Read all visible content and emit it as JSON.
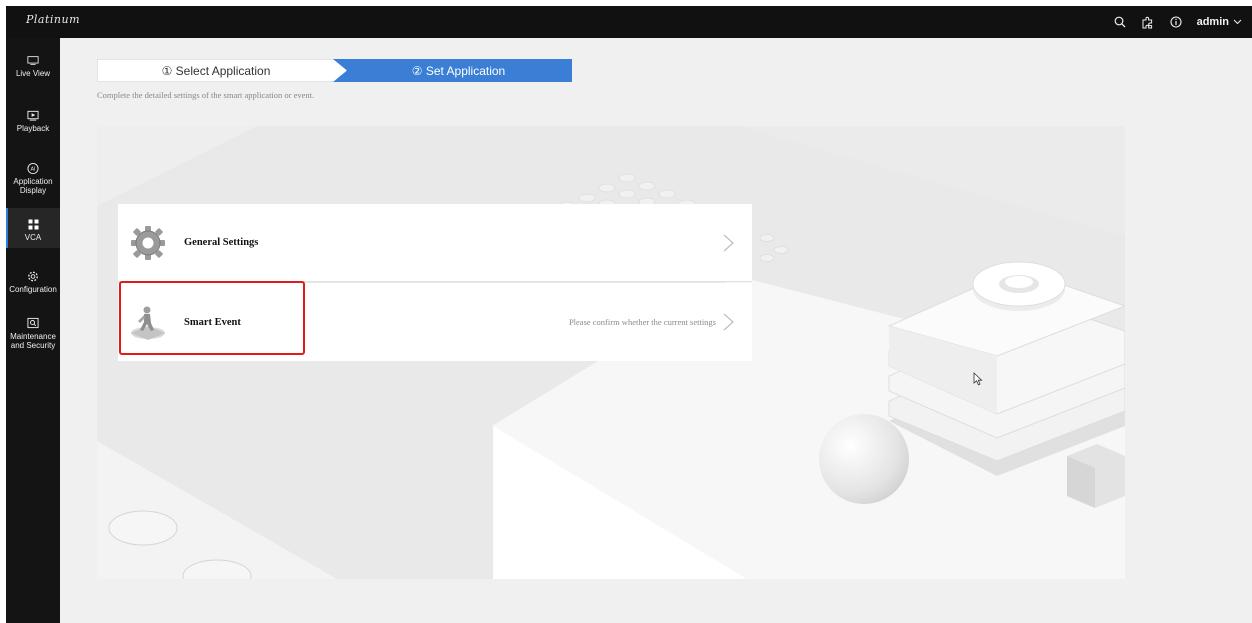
{
  "app": {
    "logo": "Platinum"
  },
  "header": {
    "user": "admin"
  },
  "sidebar": {
    "items": [
      {
        "label": "Live View",
        "icon": "monitor-icon"
      },
      {
        "label": "Playback",
        "icon": "play-icon"
      },
      {
        "label": "Application Display",
        "icon": "ai-icon"
      },
      {
        "label": "VCA",
        "icon": "grid-icon",
        "active": true
      },
      {
        "label": "Configuration",
        "icon": "gear-icon"
      },
      {
        "label": "Maintenance and Security",
        "icon": "shield-icon"
      }
    ]
  },
  "steps": {
    "step1": "① Select Application",
    "step2": "② Set Application"
  },
  "hint": "Complete the detailed settings of the smart application or event.",
  "menu": {
    "general": {
      "label": "General Settings"
    },
    "smart": {
      "label": "Smart Event",
      "note": "Please confirm whether the current settings"
    }
  },
  "colors": {
    "accent": "#3a7fd5",
    "highlight": "#e01b1b",
    "topbar": "#111111"
  }
}
